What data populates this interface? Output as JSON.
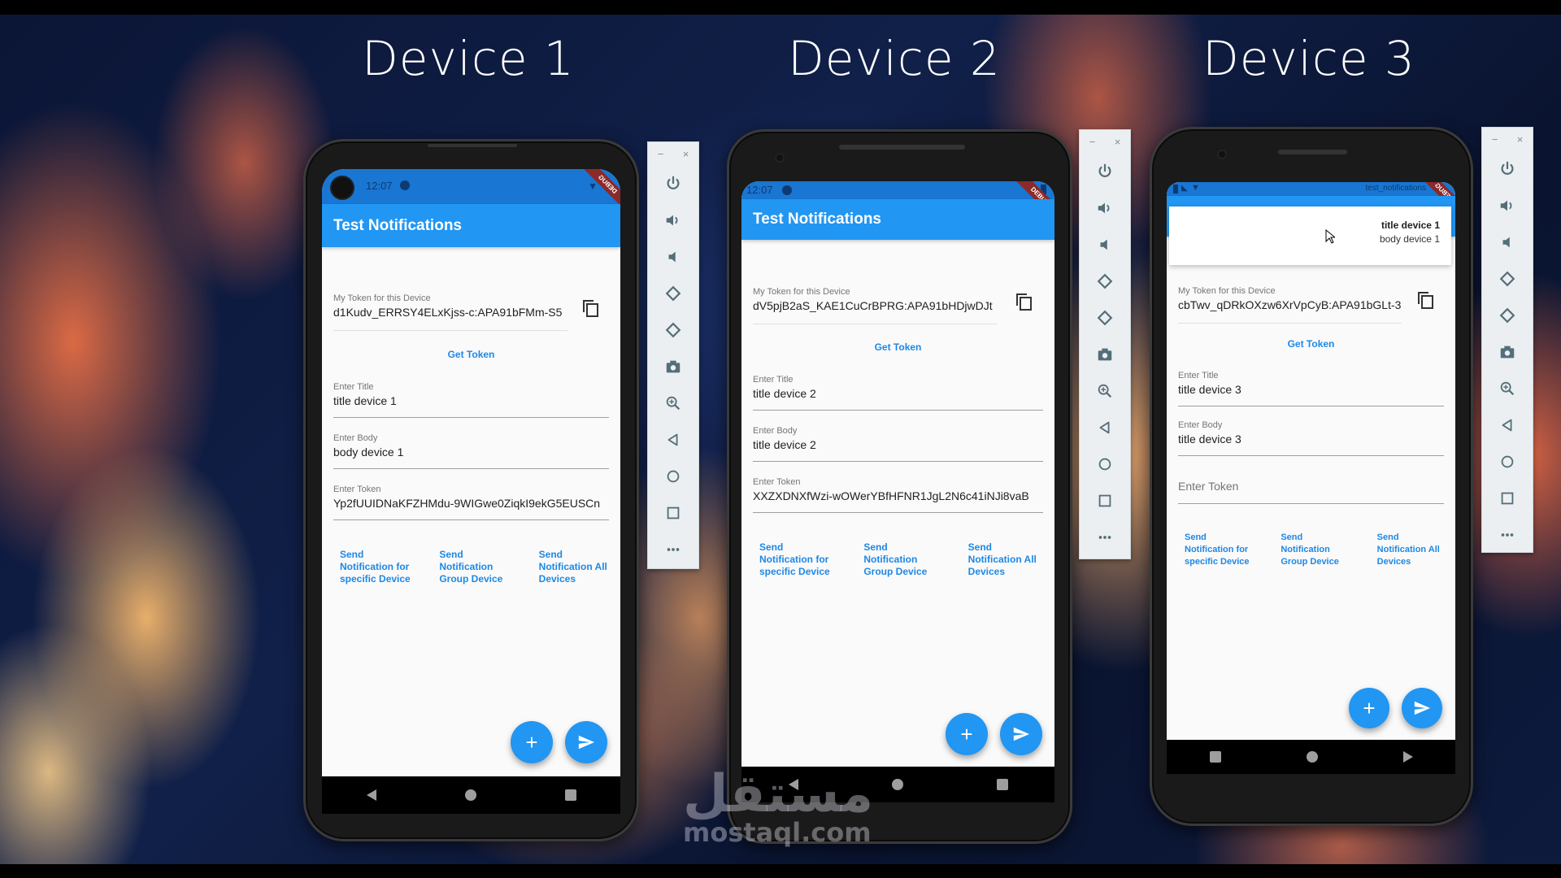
{
  "titles": [
    "Device 1",
    "Device 2",
    "Device 3"
  ],
  "app": {
    "title": "Test Notifications",
    "debug_banner": "DEBUG",
    "token_label": "My Token for this Device",
    "get_token": "Get Token",
    "title_label": "Enter Title",
    "body_label": "Enter Body",
    "token_field_label": "Enter Token",
    "send_buttons": [
      "Send Notification for specific Device",
      "Send Notification Group Device",
      "Send Notification All Devices"
    ],
    "fab_add": "+",
    "fab_send_icon": "send-icon",
    "accent": "#2196f3",
    "statusbar_color": "#1976d2"
  },
  "devices": [
    {
      "status_time": "12:07",
      "my_token": "d1Kudv_ERRSY4ELxKjss-c:APA91bFMm-S5",
      "title_value": "title device 1",
      "body_value": "body device 1",
      "token_value": "Yp2fUUIDNaKFZHMdu-9WIGwe0ZiqkI9ekG5EUSCn"
    },
    {
      "status_time": "12:07",
      "my_token": "dV5pjB2aS_KAE1CuCrBPRG:APA91bHDjwDJt",
      "title_value": "title device 2",
      "body_value": "title device 2",
      "token_value": "XXZXDNXfWzi-wOWerYBfHFNR1JgL2N6c41iNJi8vaB"
    },
    {
      "status_app": "test_notifications",
      "my_token": "cbTwv_qDRkOXzw6XrVpCyB:APA91bGLt-3",
      "title_value": "title device 3",
      "body_value": "title device 3",
      "token_placeholder": "Enter Token",
      "notification": {
        "title": "title device 1",
        "body": "body device 1"
      }
    }
  ],
  "emulator_panel": {
    "minimize": "−",
    "close": "×",
    "items": [
      "power-icon",
      "volume-up-icon",
      "volume-down-icon",
      "rotate-left-icon",
      "rotate-right-icon",
      "camera-icon",
      "zoom-icon",
      "back-icon",
      "home-icon",
      "overview-icon",
      "more-icon"
    ]
  },
  "watermark": {
    "arabic": "مستقل",
    "latin": "mostaql.com"
  }
}
